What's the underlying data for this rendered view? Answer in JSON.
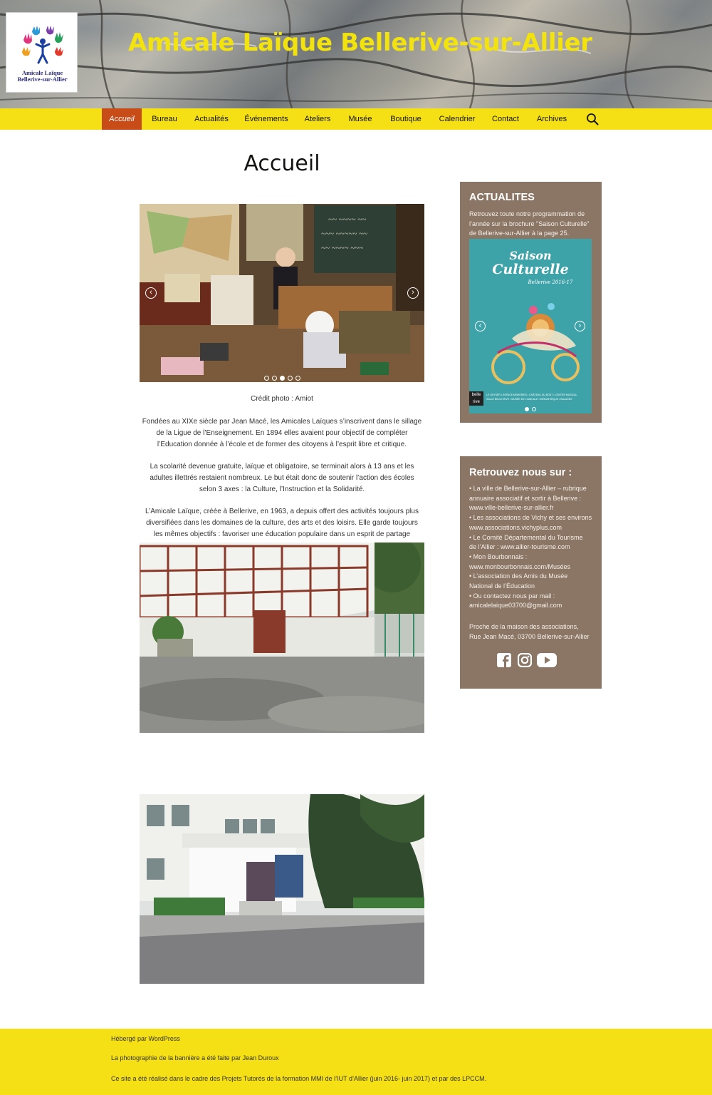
{
  "site": {
    "title": "Amicale Laïque Bellerive-sur-Allier",
    "logo_line1": "Amicale Laïque",
    "logo_line2": "Bellerive-sur-Allier"
  },
  "nav": {
    "items": [
      "Accueil",
      "Bureau",
      "Actualités",
      "Événements",
      "Ateliers",
      "Musée",
      "Boutique",
      "Calendrier",
      "Contact",
      "Archives"
    ],
    "active": "Accueil",
    "search_icon": "search-icon"
  },
  "main": {
    "title": "Accueil",
    "slider": {
      "dots": 5,
      "active_dot": 3
    },
    "photo_credit": "Crédit photo : Amiot",
    "paragraphs": [
      [
        "Fondées au XIXe siècle par Jean Macé, les Amicales Laïques s’inscrivent dans le sillage",
        "de la Ligue de l’Enseignement. En 1894 elles avaient pour objectif de compléter",
        "l’Education donnée à l’école et de former des citoyens à l’esprit libre et critique."
      ],
      [
        "La scolarité devenue gratuite, laïque et obligatoire, se terminait alors à 13 ans et les",
        "adultes illettrés restaient nombreux. Le but était donc de soutenir l’action des écoles",
        "selon 3 axes : la Culture, l’Instruction et la Solidarité."
      ],
      [
        "L’Amicale Laïque, créée à Bellerive, en 1963, a depuis offert des activités toujours plus",
        "diversifiées dans les domaines de la culture, des arts et des loisirs. Elle garde toujours",
        "les mêmes objectifs : favoriser une éducation populaire dans un esprit de partage"
      ]
    ]
  },
  "sidebar": {
    "news": {
      "title": "ACTUALITES",
      "text": [
        "Retrouvez toute notre programmation de",
        "l’année sur la brochure \"Saison Culturelle\"",
        "de Bellerive-sur-Allier à la page 25."
      ],
      "poster_title": "Saison",
      "poster_subtitle": "Culturelle",
      "poster_years": "Bellerive 2016-17",
      "poster_brand": "belle rive",
      "poster_footer": [
        "LE GEYSER • ESPACE MEMORIES • CHÂTEAU DU BOST • CENTRE MUSICAL",
        "SALLE BELLE-RIVE • MUSÉE DE L'AMICALE • MÉDIATHÈQUE • BALADES"
      ],
      "dots": 2,
      "active_dot": 1
    },
    "find": {
      "title": "Retrouvez nous sur :",
      "lines": [
        "• La ville de Bellerive-sur-Allier – rubrique",
        "annuaire associatif et sortir à Bellerive :",
        "www.ville-bellerive-sur-allier.fr",
        "• Les associations de Vichy et ses environs",
        "www.associations.vichyplus.com",
        "• Le Comité Départemental du Tourisme",
        "de l’Allier : www.allier-tourisme.com",
        "• Mon Bourbonnais :",
        "www.monbourbonnais.com/Musées",
        "• L’association des Amis du Musée",
        "National de l’Éducation",
        "• Ou contactez nous par mail :",
        "amicalelaique03700@gmail.com"
      ],
      "address": [
        "Proche de la maison des associations,",
        "Rue Jean Macé, 03700 Bellerive-sur-Allier"
      ],
      "social_icons": [
        "facebook-icon",
        "instagram-icon",
        "youtube-icon"
      ]
    }
  },
  "footer": {
    "lines": [
      "Hébergé par WordPress",
      "La photographie de la bannière a été faite par Jean Duroux",
      "Ce site a été réalisé dans le cadre des Projets Tutorés de la formation MMI de l’IUT d’Allier (juin 2016- juin 2017) et par des LPCCM."
    ]
  },
  "colors": {
    "nav_bg": "#f5e016",
    "nav_active": "#c74c18",
    "title_yellow": "#f2e30f",
    "widget_bg": "#8b7665",
    "poster_bg": "#3ea3a9"
  }
}
